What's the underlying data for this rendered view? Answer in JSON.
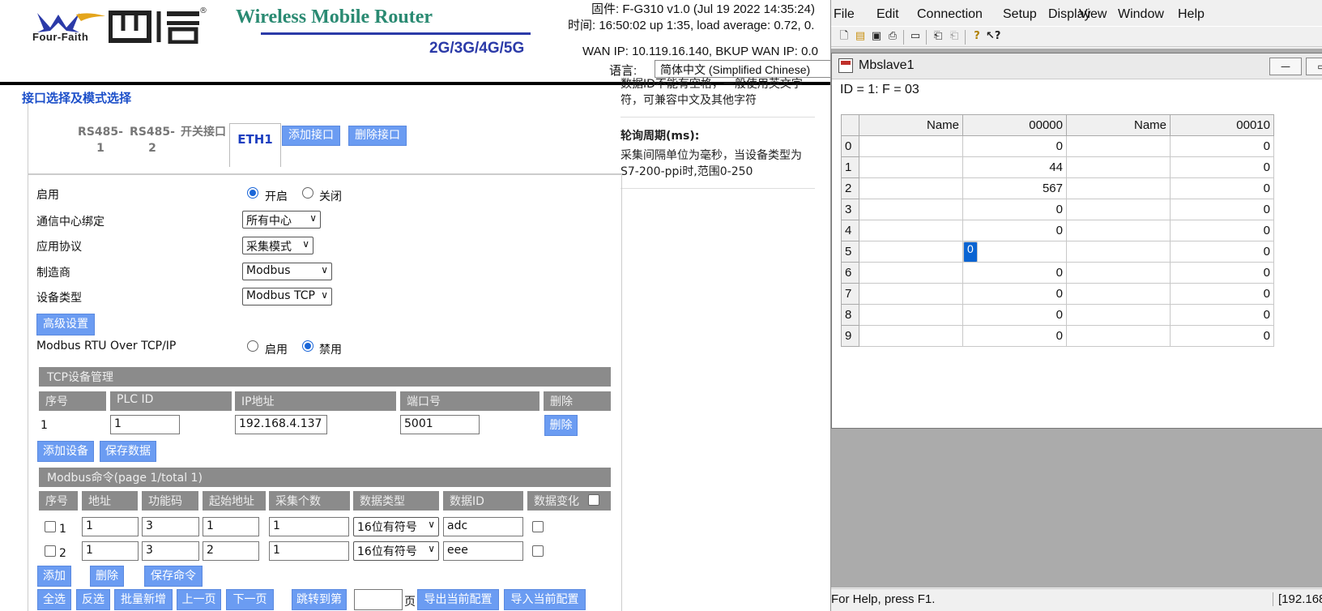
{
  "router": {
    "brand": {
      "logo_text": "Four-Faith",
      "registered": "®",
      "title": "Wireless Mobile Router",
      "subtitle": "2G/3G/4G/5G"
    },
    "info": {
      "firmware": "固件: F-G310 v1.0 (Jul 19 2022 14:35:24)",
      "time": "时间: 16:50:02 up 1:35, load average: 0.72, 0.",
      "wan": "WAN IP: 10.119.16.140, BKUP WAN IP: 0.0",
      "lang_label": "语言:",
      "lang_value": "简体中文 (Simplified Chinese)"
    },
    "section_title": "接口选择及模式选择",
    "tabs": {
      "rs485_1": "RS485-1",
      "rs485_2": "RS485-2",
      "switch": "开关接口",
      "eth1": "ETH1",
      "add": "添加接口",
      "delete": "删除接口"
    },
    "help": {
      "line1": "数据ID不能有空格，一般使用英文字",
      "line2": "符，可兼容中文及其他字符",
      "poll_title": "轮询周期(ms):",
      "poll_line1": "采集间隔单位为毫秒，当设备类型为",
      "poll_line2": "S7-200-ppi时,范围0-250"
    },
    "form": {
      "enable_label": "启用",
      "enable_on": "开启",
      "enable_off": "关闭",
      "center_label": "通信中心绑定",
      "center_value": "所有中心",
      "protocol_label": "应用协议",
      "protocol_value": "采集模式",
      "vendor_label": "制造商",
      "vendor_value": "Modbus",
      "device_label": "设备类型",
      "device_value": "Modbus TCP",
      "advanced_btn": "高级设置",
      "rtu_label": "Modbus RTU Over TCP/IP",
      "rtu_on": "启用",
      "rtu_off": "禁用"
    },
    "tcp": {
      "title": "TCP设备管理",
      "headers": [
        "序号",
        "PLC ID",
        "IP地址",
        "端口号",
        "删除"
      ],
      "row": {
        "no": "1",
        "plc_id": "1",
        "ip": "192.168.4.137",
        "port": "5001",
        "delete": "删除"
      },
      "add_btn": "添加设备",
      "save_btn": "保存数据"
    },
    "modbus": {
      "title": "Modbus命令(page 1/total 1)",
      "headers": [
        "序号",
        "地址",
        "功能码",
        "起始地址",
        "采集个数",
        "数据类型",
        "数据ID",
        "数据变化"
      ],
      "rows": [
        {
          "no": "1",
          "addr": "1",
          "func": "3",
          "start": "1",
          "count": "1",
          "type": "16位有符号",
          "id": "adc"
        },
        {
          "no": "2",
          "addr": "1",
          "func": "3",
          "start": "2",
          "count": "1",
          "type": "16位有符号",
          "id": "eee"
        }
      ],
      "add_btn": "添加",
      "delete_btn": "删除",
      "save_btn": "保存命令",
      "select_all": "全选",
      "invert": "反选",
      "batch_add": "批量新增",
      "prev": "上一页",
      "next": "下一页",
      "jump": "跳转到第",
      "page_suffix": "页",
      "export": "导出当前配置",
      "import": "导入当前配置"
    }
  },
  "app": {
    "menu": [
      "File",
      "Edit",
      "Connection",
      "Setup",
      "Display",
      "View",
      "Window",
      "Help"
    ],
    "child_title": "Mbslave1",
    "id_line": "ID = 1: F = 03",
    "grid": {
      "headers": [
        "Name",
        "00000",
        "Name",
        "00010"
      ],
      "rows": [
        {
          "idx": "0",
          "v1": "0",
          "v2": "0"
        },
        {
          "idx": "1",
          "v1": "44",
          "v2": "0"
        },
        {
          "idx": "2",
          "v1": "567",
          "v2": "0"
        },
        {
          "idx": "3",
          "v1": "0",
          "v2": "0"
        },
        {
          "idx": "4",
          "v1": "0",
          "v2": "0"
        },
        {
          "idx": "5",
          "v1": "0",
          "v2": "0"
        },
        {
          "idx": "6",
          "v1": "0",
          "v2": "0"
        },
        {
          "idx": "7",
          "v1": "0",
          "v2": "0"
        },
        {
          "idx": "8",
          "v1": "0",
          "v2": "0"
        },
        {
          "idx": "9",
          "v1": "0",
          "v2": "0"
        }
      ]
    },
    "status_left": "For Help, press F1.",
    "status_right": "[192.168"
  },
  "colors": {
    "accent_blue": "#6b9cf2",
    "brand_green": "#2a8a72",
    "brand_navy": "#2b3aa8",
    "selection": "#0a64d2"
  }
}
